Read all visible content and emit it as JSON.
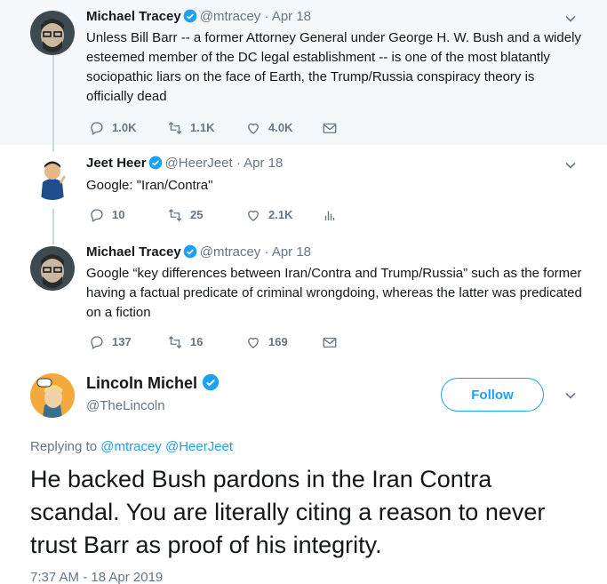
{
  "colors": {
    "accent": "#1da1f2",
    "muted": "#657786",
    "thread_line": "#ccd6dd",
    "shaded_bg": "#f5f8fa"
  },
  "tweets": [
    {
      "name": "Michael Tracey",
      "handle": "@mtracey",
      "dot": "·",
      "date": "Apr 18",
      "text": "Unless Bill Barr -- a former Attorney General under George H. W. Bush and a widely esteemed member of the DC legal establishment -- is one of the most blatantly sociopathic liars on the face of Earth, the Trump/Russia conspiracy theory is officially dead",
      "replies": "1.0K",
      "retweets": "1.1K",
      "likes": "4.0K",
      "extra_icon": "mail-icon"
    },
    {
      "name": "Jeet Heer",
      "handle": "@HeerJeet",
      "dot": "·",
      "date": "Apr 18",
      "text": "Google: \"Iran/Contra\"",
      "replies": "10",
      "retweets": "25",
      "likes": "2.1K",
      "extra_icon": "analytics-icon"
    },
    {
      "name": "Michael Tracey",
      "handle": "@mtracey",
      "dot": "·",
      "date": "Apr 18",
      "text": "Google “key differences between Iran/Contra and Trump/Russia” such as the former having a factual predicate of criminal wrongdoing, whereas the latter was predicated on a fiction",
      "replies": "137",
      "retweets": "16",
      "likes": "169",
      "extra_icon": "mail-icon"
    }
  ],
  "main_tweet": {
    "name": "Lincoln Michel",
    "handle": "@TheLincoln",
    "follow_label": "Follow",
    "replying_prefix": "Replying to",
    "replying_to_1": "@mtracey",
    "replying_to_2": "@HeerJeet",
    "text": "He backed Bush pardons in the Iran Contra scandal. You are literally citing a reason to never trust Barr as proof of his integrity.",
    "timestamp": "7:37 AM - 18 Apr 2019"
  }
}
